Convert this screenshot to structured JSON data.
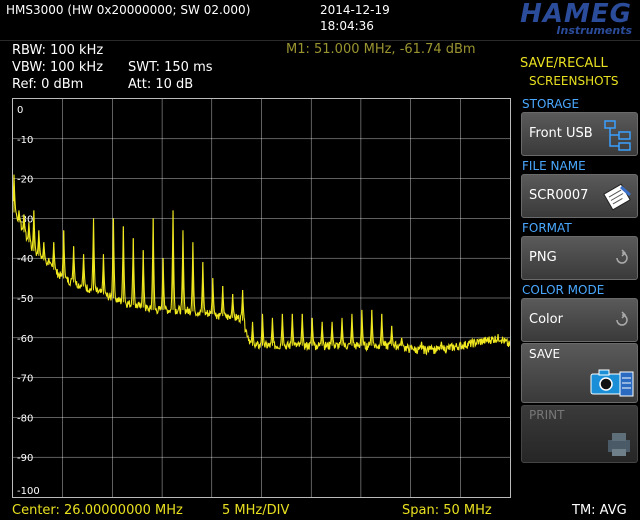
{
  "header": {
    "device_info": "HMS3000 (HW 0x20000000; SW 02.000)",
    "date": "2014-12-19",
    "time": "18:04:36",
    "logo_text": "HAMEG",
    "logo_sub": "Instruments"
  },
  "params": {
    "rbw": "RBW: 100 kHz",
    "vbw": "VBW: 100 kHz",
    "ref": "Ref: 0 dBm",
    "swt": "SWT: 150 ms",
    "att": "Att: 10 dB",
    "marker": "M1: 51.000 MHz, -61.74 dBm"
  },
  "side_panel": {
    "title_line1": "SAVE/RECALL",
    "title_line2": "SCREENSHOTS",
    "storage_heading": "STORAGE",
    "storage_value": "Front USB",
    "file_name_heading": "FILE NAME",
    "file_name_value": "SCR0007",
    "format_heading": "FORMAT",
    "format_value": "PNG",
    "color_mode_heading": "COLOR MODE",
    "color_mode_value": "Color",
    "save_label": "SAVE",
    "print_label": "PRINT"
  },
  "footer": {
    "center": "Center: 26.00000000 MHz",
    "scale": "5 MHz/DIV",
    "span": "Span: 50 MHz",
    "trace_mode": "TM: AVG"
  },
  "colors": {
    "trace": "#f0e81e",
    "grid": "#ffffff",
    "marker_text": "#9a9430",
    "heading": "#4aa8ff"
  },
  "chart_data": {
    "type": "line",
    "x_unit": "MHz",
    "y_unit": "dBm",
    "xlim": [
      1,
      51
    ],
    "ylim": [
      -100,
      0
    ],
    "y_ticks": [
      0,
      -10,
      -20,
      -30,
      -40,
      -50,
      -60,
      -70,
      -80,
      -90,
      -100
    ],
    "y_tick_labels": [
      "0",
      "-10",
      "-20",
      "-30",
      "-40",
      "-50",
      "-60",
      "-70",
      "-80",
      "-90",
      "-100"
    ],
    "grid": true,
    "series": [
      {
        "floor_x": [
          1,
          3,
          6,
          9,
          12,
          15,
          18,
          21,
          23,
          24,
          25,
          27,
          30,
          33,
          36,
          40,
          41,
          44,
          46,
          48,
          50,
          51
        ],
        "floor_y": [
          -28,
          -38,
          -45,
          -48,
          -51,
          -53,
          -53,
          -54,
          -55,
          -55,
          -62,
          -62,
          -62,
          -62,
          -62,
          -62,
          -63,
          -63,
          -62,
          -61,
          -60,
          -62
        ],
        "peaks": [
          {
            "x": 1.1,
            "y": -19
          },
          {
            "x": 1.6,
            "y": -28
          },
          {
            "x": 2.1,
            "y": -29
          },
          {
            "x": 2.6,
            "y": -31
          },
          {
            "x": 3.1,
            "y": -28
          },
          {
            "x": 3.6,
            "y": -33
          },
          {
            "x": 4.1,
            "y": -36
          },
          {
            "x": 4.6,
            "y": -40
          },
          {
            "x": 5.1,
            "y": -36
          },
          {
            "x": 6.1,
            "y": -33
          },
          {
            "x": 7.1,
            "y": -37
          },
          {
            "x": 8.1,
            "y": -39
          },
          {
            "x": 9.1,
            "y": -30
          },
          {
            "x": 10.1,
            "y": -39
          },
          {
            "x": 11.1,
            "y": -30
          },
          {
            "x": 12.1,
            "y": -32
          },
          {
            "x": 13.1,
            "y": -35
          },
          {
            "x": 14.1,
            "y": -38
          },
          {
            "x": 15.1,
            "y": -30
          },
          {
            "x": 16.1,
            "y": -40
          },
          {
            "x": 17.1,
            "y": -28
          },
          {
            "x": 18.1,
            "y": -33
          },
          {
            "x": 19.1,
            "y": -36
          },
          {
            "x": 20.1,
            "y": -41
          },
          {
            "x": 21.1,
            "y": -45
          },
          {
            "x": 22.1,
            "y": -47
          },
          {
            "x": 23.1,
            "y": -49
          },
          {
            "x": 24.1,
            "y": -48
          },
          {
            "x": 25.1,
            "y": -56
          },
          {
            "x": 26.1,
            "y": -54
          },
          {
            "x": 27.1,
            "y": -55
          },
          {
            "x": 28.1,
            "y": -54
          },
          {
            "x": 29.1,
            "y": -54
          },
          {
            "x": 30.1,
            "y": -54
          },
          {
            "x": 31.1,
            "y": -55
          },
          {
            "x": 32.1,
            "y": -56
          },
          {
            "x": 33.1,
            "y": -56
          },
          {
            "x": 34.1,
            "y": -55
          },
          {
            "x": 35.1,
            "y": -54
          },
          {
            "x": 36.1,
            "y": -53
          },
          {
            "x": 37.1,
            "y": -53
          },
          {
            "x": 38.1,
            "y": -54
          },
          {
            "x": 39.1,
            "y": -57
          },
          {
            "x": 40.1,
            "y": -60
          },
          {
            "x": 41.1,
            "y": -62
          },
          {
            "x": 42.1,
            "y": -61
          },
          {
            "x": 43.1,
            "y": -62
          },
          {
            "x": 44.1,
            "y": -61
          }
        ]
      }
    ]
  }
}
